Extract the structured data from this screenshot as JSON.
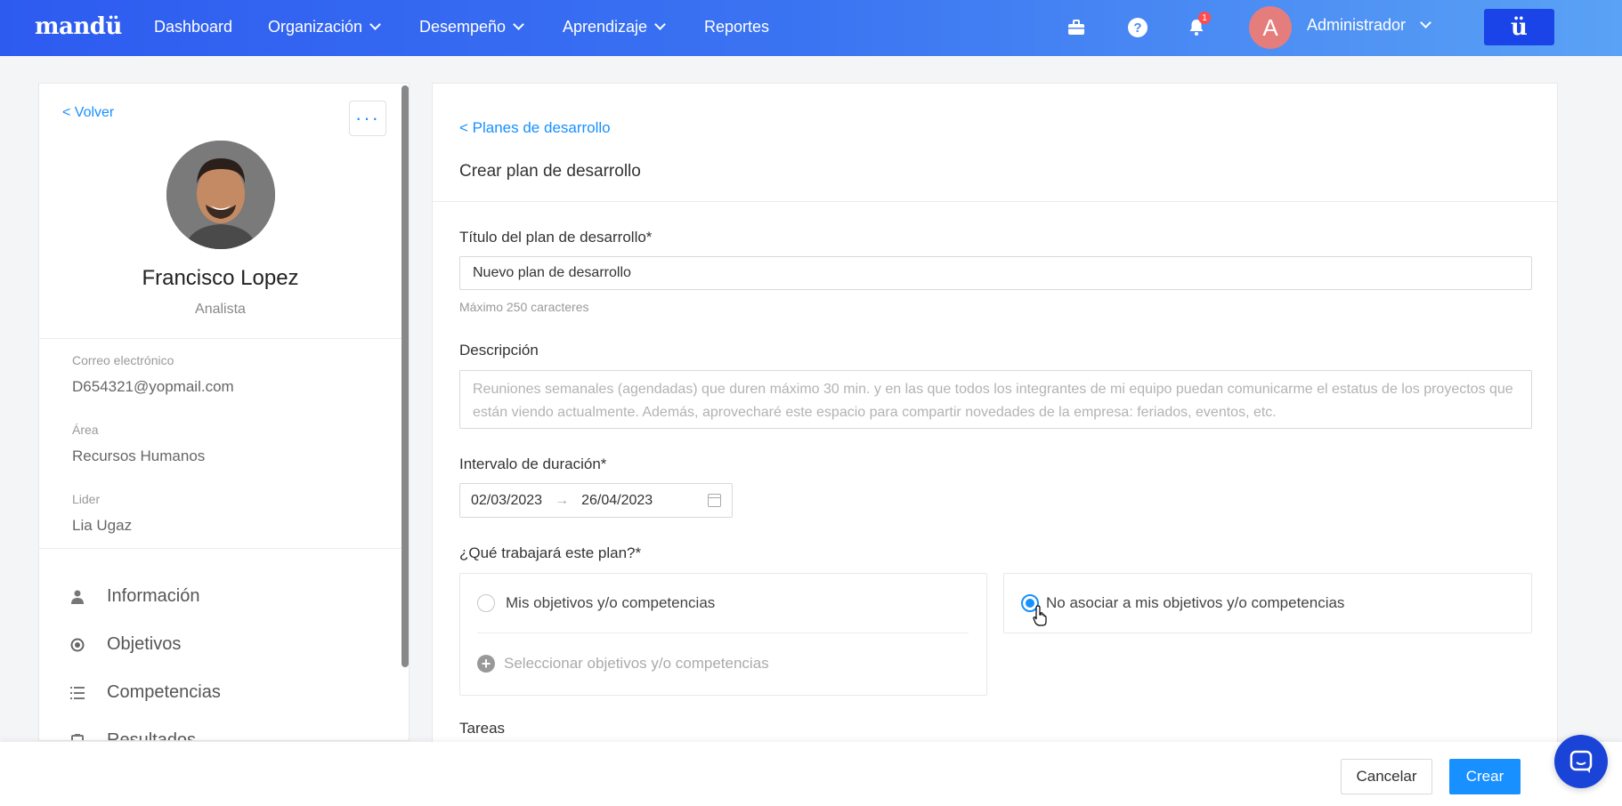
{
  "topbar": {
    "logo": "mandü",
    "nav": [
      {
        "label": "Dashboard",
        "has_dropdown": false
      },
      {
        "label": "Organización",
        "has_dropdown": true
      },
      {
        "label": "Desempeño",
        "has_dropdown": true
      },
      {
        "label": "Aprendizaje",
        "has_dropdown": true
      },
      {
        "label": "Reportes",
        "has_dropdown": false
      }
    ],
    "icons": [
      "briefcase-icon",
      "help-icon",
      "bell-icon"
    ],
    "help_glyph": "?",
    "notification_count": "1",
    "avatar_letter": "A",
    "user_name": "Administrador",
    "brand_button": "ü",
    "gradient": [
      "#2d5bf0",
      "#5aa2f5"
    ]
  },
  "profile": {
    "back_label": "< Volver",
    "more_label": "···",
    "name": "Francisco Lopez",
    "role": "Analista",
    "fields": [
      {
        "label": "Correo electrónico",
        "value": "D654321@yopmail.com"
      },
      {
        "label": "Área",
        "value": "Recursos Humanos"
      },
      {
        "label": "Lider",
        "value": "Lia Ugaz"
      }
    ],
    "menu": [
      {
        "label": "Información",
        "icon": "user-icon"
      },
      {
        "label": "Objetivos",
        "icon": "target-icon"
      },
      {
        "label": "Competencias",
        "icon": "list-icon"
      },
      {
        "label": "Resultados",
        "icon": "clipboard-icon"
      }
    ]
  },
  "form": {
    "breadcrumb": "< Planes de desarrollo",
    "title": "Crear plan de desarrollo",
    "title_label": "Título del plan de desarrollo*",
    "title_value": "Nuevo plan de desarrollo",
    "title_hint": "Máximo 250 caracteres",
    "description_label": "Descripción",
    "description_placeholder": "Reuniones semanales (agendadas) que duren máximo 30 min. y en las que todos los integrantes de mi equipo puedan comunicarme el estatus de los proyectos que están viendo actualmente. Además, aprovecharé este espacio para compartir novedades de la empresa: feriados, eventos, etc.",
    "duration_label": "Intervalo de duración*",
    "start_date": "02/03/2023",
    "range_separator": "→",
    "end_date": "26/04/2023",
    "scope_label": "¿Qué trabajará este plan?*",
    "option_objectives": "Mis objetivos y/o competencias",
    "option_objectives_checked": false,
    "select_objectives": "Seleccionar objetivos y/o competencias",
    "option_no_assoc": "No asociar a mis objetivos y/o competencias",
    "option_no_assoc_checked": true,
    "tasks_label": "Tareas"
  },
  "footer": {
    "cancel_label": "Cancelar",
    "create_label": "Crear",
    "accent": "#1890ff"
  }
}
